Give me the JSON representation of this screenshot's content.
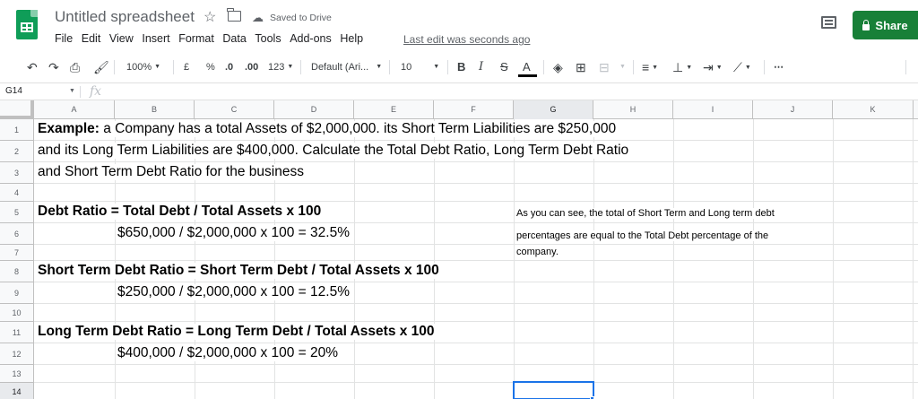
{
  "app": {
    "title": "Untitled spreadsheet",
    "saved_status": "Saved to Drive",
    "last_edit": "Last edit was seconds ago",
    "share_label": "Share"
  },
  "menu": [
    "File",
    "Edit",
    "View",
    "Insert",
    "Format",
    "Data",
    "Tools",
    "Add-ons",
    "Help"
  ],
  "toolbar": {
    "zoom": "100%",
    "currency": "£",
    "percent": "%",
    "dec_decrease": ".0",
    "dec_increase": ".00",
    "number_format": "123",
    "font": "Default (Ari...",
    "font_size": "10",
    "bold": "B",
    "italic": "I",
    "strike": "S",
    "text_color": "A",
    "more": "⋯"
  },
  "formula_bar": {
    "name_box": "G14",
    "fx": "fx"
  },
  "columns": [
    "A",
    "B",
    "C",
    "D",
    "E",
    "F",
    "G",
    "H",
    "I",
    "J",
    "K"
  ],
  "rows": [
    "1",
    "2",
    "3",
    "4",
    "5",
    "6",
    "7",
    "8",
    "9",
    "10",
    "11",
    "12",
    "13",
    "14"
  ],
  "cells": {
    "r1_label": "Example:",
    "r1_text": " a Company has a total Assets of $2,000,000. its Short Term Liabilities are $250,000",
    "r2": "and its Long Term Liabilities are $400,000. Calculate the Total Debt Ratio, Long Term Debt Ratio",
    "r3": "and Short Term Debt Ratio for the business",
    "r5": "Debt Ratio = Total Debt / Total Assets x 100",
    "r6": "$650,000 / $2,000,000 x 100 = 32.5%",
    "r8": "Short Term Debt Ratio = Short Term Debt / Total Assets x 100",
    "r9": "$250,000 / $2,000,000 x 100 = 12.5%",
    "r11": "Long Term Debt Ratio = Long Term Debt / Total Assets x 100",
    "r12": "$400,000 / $2,000,000 x 100 = 20%",
    "g5": "As you can see, the total of Short Term and Long term debt",
    "g6": "percentages are equal to the Total Debt percentage of the",
    "g7": "company."
  },
  "colors": {
    "share": "#188038",
    "logo": "#0f9d58",
    "selection": "#1a73e8"
  }
}
